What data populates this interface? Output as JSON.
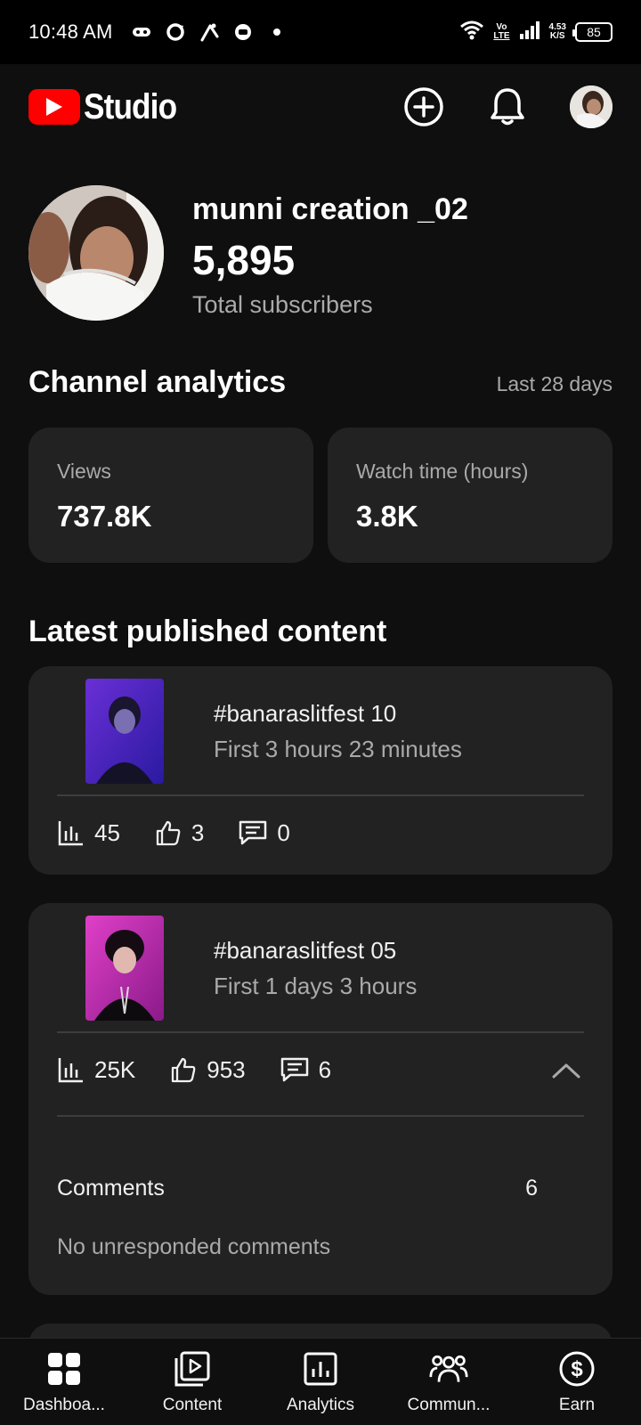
{
  "status_bar": {
    "time": "10:48 AM",
    "network_speed": "4.53",
    "network_unit": "K/S",
    "volte": "Vo",
    "lte": "LTE",
    "battery": "85"
  },
  "header": {
    "brand_text": "Studio",
    "brand_color": "#ff0000"
  },
  "channel": {
    "name": "munni creation _02",
    "subscribers": "5,895",
    "subscribers_label": "Total subscribers"
  },
  "analytics": {
    "title": "Channel analytics",
    "range": "Last 28 days",
    "cards": [
      {
        "label": "Views",
        "value": "737.8K"
      },
      {
        "label": "Watch time (hours)",
        "value": "3.8K"
      }
    ]
  },
  "latest": {
    "title": "Latest published content",
    "items": [
      {
        "title": "#banaraslitfest 10",
        "subtitle": "First 3 hours 23 minutes",
        "views": "45",
        "likes": "3",
        "comments": "0"
      },
      {
        "title": "#banaraslitfest 05",
        "subtitle": "First 1 days 3 hours",
        "views": "25K",
        "likes": "953",
        "comments": "6",
        "comments_label": "Comments",
        "comments_count": "6",
        "no_unresponded": "No unresponded comments"
      }
    ]
  },
  "bottom_nav": [
    {
      "label": "Dashboa...",
      "icon": "dashboard-icon"
    },
    {
      "label": "Content",
      "icon": "content-icon"
    },
    {
      "label": "Analytics",
      "icon": "analytics-icon"
    },
    {
      "label": "Commun...",
      "icon": "community-icon"
    },
    {
      "label": "Earn",
      "icon": "earn-icon"
    }
  ]
}
